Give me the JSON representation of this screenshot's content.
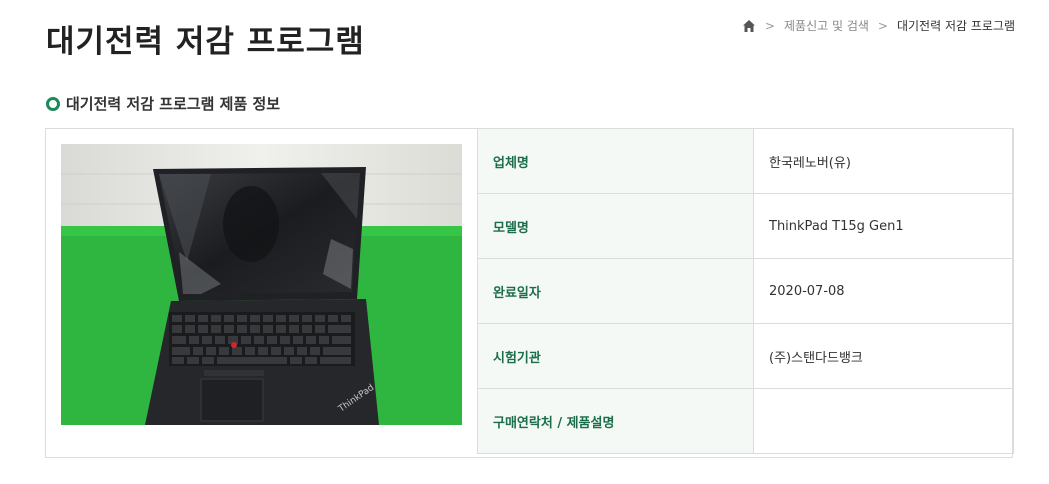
{
  "page": {
    "title": "대기전력 저감 프로그램"
  },
  "breadcrumb": {
    "home_icon": "home-icon",
    "items": [
      "제품신고 및 검색",
      "대기전력 저감 프로그램"
    ]
  },
  "section": {
    "title": "대기전력 저감 프로그램 제품 정보",
    "accent_color": "#1a8a5a"
  },
  "product": {
    "image_logo_text": "ThinkPad",
    "fields": [
      {
        "label": "업체명",
        "value": "한국레노버(유)"
      },
      {
        "label": "모델명",
        "value": "ThinkPad T15g Gen1"
      },
      {
        "label": "완료일자",
        "value": "2020-07-08"
      },
      {
        "label": "시험기관",
        "value": "(주)스탠다드뱅크"
      },
      {
        "label": "구매연락처 / 제품설명",
        "value": ""
      }
    ]
  }
}
